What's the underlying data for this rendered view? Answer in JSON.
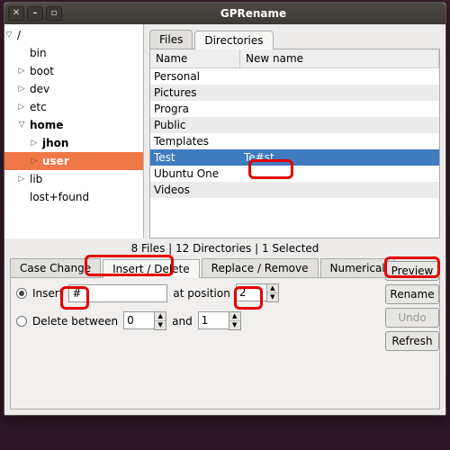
{
  "title": "GPRename",
  "tree": [
    {
      "depth": 0,
      "exp": "open",
      "label": "/",
      "bold": false
    },
    {
      "depth": 1,
      "exp": "",
      "label": "bin"
    },
    {
      "depth": 1,
      "exp": "closed",
      "label": "boot"
    },
    {
      "depth": 1,
      "exp": "closed",
      "label": "dev"
    },
    {
      "depth": 1,
      "exp": "closed",
      "label": "etc"
    },
    {
      "depth": 1,
      "exp": "open",
      "label": "home",
      "bold": true
    },
    {
      "depth": 2,
      "exp": "closed",
      "label": "jhon",
      "bold": true
    },
    {
      "depth": 2,
      "exp": "closed",
      "label": "user",
      "bold": true,
      "sel": true
    },
    {
      "depth": 1,
      "exp": "closed",
      "label": "lib"
    },
    {
      "depth": 1,
      "exp": "",
      "label": "lost+found"
    }
  ],
  "tabs_top": {
    "files": "Files",
    "dirs": "Directories"
  },
  "list_headers": {
    "name": "Name",
    "newname": "New name"
  },
  "list": [
    {
      "name": "Personal",
      "new": ""
    },
    {
      "name": "Pictures",
      "new": ""
    },
    {
      "name": "Progra",
      "new": ""
    },
    {
      "name": "Public",
      "new": ""
    },
    {
      "name": "Templates",
      "new": ""
    },
    {
      "name": "Test",
      "new": "Te#st",
      "sel": true
    },
    {
      "name": "Ubuntu One",
      "new": ""
    },
    {
      "name": "Videos",
      "new": ""
    }
  ],
  "status": "8 Files | 12 Directories | 1 Selected",
  "tabs_bottom": {
    "case": "Case Change",
    "ins": "Insert / Delete",
    "rep": "Replace / Remove",
    "num": "Numerical"
  },
  "form": {
    "insert_label": "Insert",
    "insert_value": "#",
    "pos_label": "at position",
    "pos_value": "2",
    "delete_label": "Delete between",
    "del_from": "0",
    "and_label": "and",
    "del_to": "1"
  },
  "buttons": {
    "preview": "Preview",
    "rename": "Rename",
    "undo": "Undo",
    "refresh": "Refresh"
  }
}
